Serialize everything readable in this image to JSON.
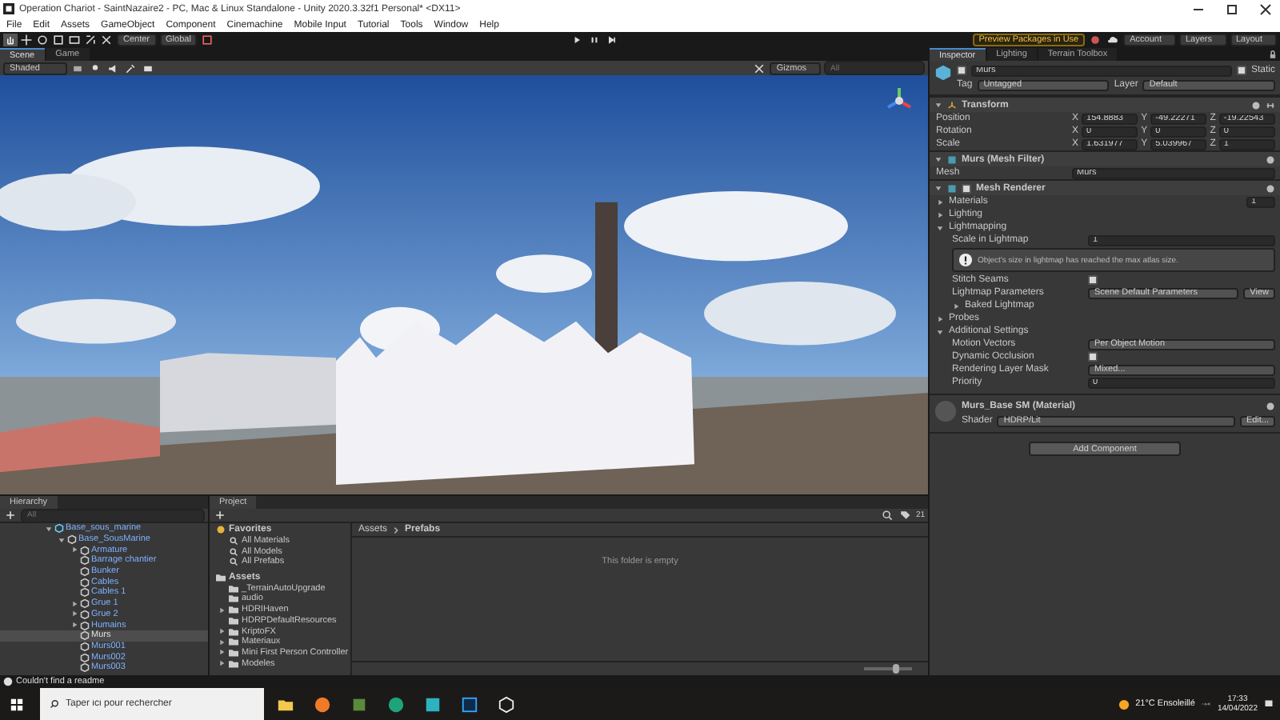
{
  "window": {
    "title": "Operation Chariot - SaintNazaire2 - PC, Mac & Linux Standalone - Unity 2020.3.32f1 Personal* <DX11>"
  },
  "menu": [
    "File",
    "Edit",
    "Assets",
    "GameObject",
    "Component",
    "Cinemachine",
    "Mobile Input",
    "Tutorial",
    "Tools",
    "Window",
    "Help"
  ],
  "toolbar": {
    "pivot": "Center",
    "handle": "Global",
    "preview": "Preview Packages in Use",
    "account": "Account",
    "layers": "Layers",
    "layout": "Layout"
  },
  "scene_tabs": [
    {
      "label": "Scene",
      "selected": true
    },
    {
      "label": "Game",
      "selected": false
    }
  ],
  "scene_toolbar": {
    "shading": "Shaded",
    "gizmos": "Gizmos",
    "search_placeholder": "All"
  },
  "inspector": {
    "tabs": [
      {
        "label": "Inspector",
        "selected": true
      },
      {
        "label": "Lighting",
        "selected": false
      },
      {
        "label": "Terrain Toolbox",
        "selected": false
      }
    ],
    "object": {
      "name": "Murs",
      "active": true,
      "static": "Static",
      "static_checked": true,
      "tag_label": "Tag",
      "tag": "Untagged",
      "layer_label": "Layer",
      "layer": "Default"
    },
    "transform": {
      "title": "Transform",
      "rows": [
        {
          "label": "Position",
          "values": [
            {
              "axis": "X",
              "value": "154.8883"
            },
            {
              "axis": "Y",
              "value": "-49.22271"
            },
            {
              "axis": "Z",
              "value": "-19.22543"
            }
          ]
        },
        {
          "label": "Rotation",
          "values": [
            {
              "axis": "X",
              "value": "0"
            },
            {
              "axis": "Y",
              "value": "0"
            },
            {
              "axis": "Z",
              "value": "0"
            }
          ]
        },
        {
          "label": "Scale",
          "values": [
            {
              "axis": "X",
              "value": "1.631977"
            },
            {
              "axis": "Y",
              "value": "5.039967"
            },
            {
              "axis": "Z",
              "value": "1"
            }
          ]
        }
      ]
    },
    "mesh_filter": {
      "title": "Murs (Mesh Filter)",
      "label": "Mesh",
      "value": "Murs"
    },
    "mesh_renderer": {
      "title": "Mesh Renderer",
      "enabled": true,
      "properties": [
        {
          "kind": "foldout",
          "label": "Materials",
          "expanded": false,
          "value": "1"
        },
        {
          "kind": "foldout",
          "label": "Lighting",
          "expanded": false
        },
        {
          "kind": "foldout",
          "label": "Lightmapping",
          "expanded": true,
          "children": [
            {
              "kind": "number",
              "label": "Scale in Lightmap",
              "value": "1"
            },
            {
              "kind": "warning",
              "text": "Object's size in lightmap has reached the max atlas size."
            },
            {
              "kind": "check",
              "label": "Stitch Seams",
              "checked": true
            },
            {
              "kind": "dropdown",
              "label": "Lightmap Parameters",
              "value": "Scene Default Parameters",
              "button": "View"
            },
            {
              "kind": "foldout",
              "label": "Baked Lightmap",
              "expanded": false
            }
          ]
        },
        {
          "kind": "foldout",
          "label": "Probes",
          "expanded": false
        },
        {
          "kind": "foldout",
          "label": "Additional Settings",
          "expanded": true,
          "children": [
            {
              "kind": "dropdown",
              "label": "Motion Vectors",
              "value": "Per Object Motion"
            },
            {
              "kind": "check",
              "label": "Dynamic Occlusion",
              "checked": true
            },
            {
              "kind": "dropdown",
              "label": "Rendering Layer Mask",
              "value": "Mixed..."
            },
            {
              "kind": "number",
              "label": "Priority",
              "value": "0"
            }
          ]
        }
      ]
    },
    "material": {
      "title": "Murs_Base SM (Material)",
      "shader_label": "Shader",
      "shader": "HDRP/Lit",
      "edit": "Edit..."
    },
    "add_component": "Add Component"
  },
  "hierarchy": {
    "title": "Hierarchy",
    "search_placeholder": "All",
    "tree": [
      {
        "label": "Base_sous_marine",
        "expanded": true,
        "selected": false,
        "children": [
          {
            "label": "Base_SousMarine",
            "expanded": true,
            "selected": false,
            "children": [
              {
                "label": "Armature",
                "expanded": false,
                "selected": false
              },
              {
                "label": "Barrage chantier",
                "selected": false
              },
              {
                "label": "Bunker",
                "selected": false
              },
              {
                "label": "Cables",
                "selected": false
              },
              {
                "label": "Cables 1",
                "selected": false
              },
              {
                "label": "Grue 1",
                "expanded": false,
                "selected": false
              },
              {
                "label": "Grue 2",
                "expanded": false,
                "selected": false
              },
              {
                "label": "Humains",
                "expanded": false,
                "selected": false
              },
              {
                "label": "Murs",
                "selected": true
              },
              {
                "label": "Murs001",
                "selected": false
              },
              {
                "label": "Murs002",
                "selected": false
              },
              {
                "label": "Murs003",
                "selected": false
              }
            ]
          }
        ]
      }
    ]
  },
  "project": {
    "title": "Project",
    "favorites": {
      "label": "Favorites",
      "items": [
        "All Materials",
        "All Models",
        "All Prefabs"
      ]
    },
    "assets": {
      "label": "Assets",
      "folders": [
        {
          "label": "_TerrainAutoUpgrade",
          "expandable": false
        },
        {
          "label": "audio",
          "expandable": false
        },
        {
          "label": "HDRIHaven",
          "expandable": true
        },
        {
          "label": "HDRPDefaultResources",
          "expandable": false
        },
        {
          "label": "KriptoFX",
          "expandable": true
        },
        {
          "label": "Materiaux",
          "expandable": true
        },
        {
          "label": "Mini First Person Controller",
          "expandable": true
        },
        {
          "label": "Modeles",
          "expandable": true
        }
      ]
    },
    "breadcrumb": [
      "Assets",
      "Prefabs"
    ],
    "empty_text": "This folder is empty",
    "count": "21",
    "zoom": {
      "level": 0.7
    }
  },
  "status_bar": {
    "message": "Couldn't find a readme"
  },
  "taskbar": {
    "search_placeholder": "Taper ici pour rechercher",
    "weather": "21°C  Ensoleillé",
    "time": "17:33",
    "date": "14/04/2022"
  }
}
